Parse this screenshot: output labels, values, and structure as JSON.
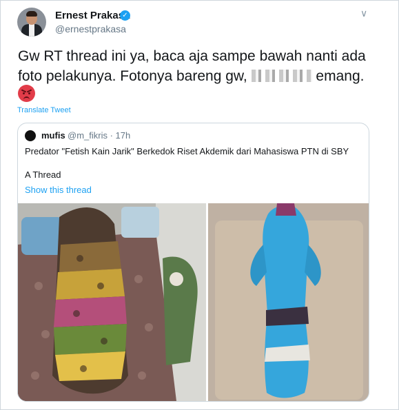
{
  "author": {
    "name": "Ernest Prakasa",
    "handle": "@ernestprakasa"
  },
  "tweet": {
    "text_before": "Gw RT thread ini ya, baca aja sampe bawah nanti ada foto pelakunya. Fotonya bareng gw, ",
    "text_after": " emang.",
    "emoji": "angry-face",
    "translate_label": "Translate Tweet"
  },
  "quoted": {
    "name": "mufis",
    "handle": "@m_fikris · 17h",
    "text": "Predator \"Fetish Kain Jarik\" Berkedok Riset Akdemik dari Mahasiswa PTN di SBY",
    "subtext": "A Thread",
    "show_thread": "Show this thread"
  },
  "colors": {
    "link": "#1da1f2",
    "muted": "#657786",
    "text": "#14171a"
  }
}
